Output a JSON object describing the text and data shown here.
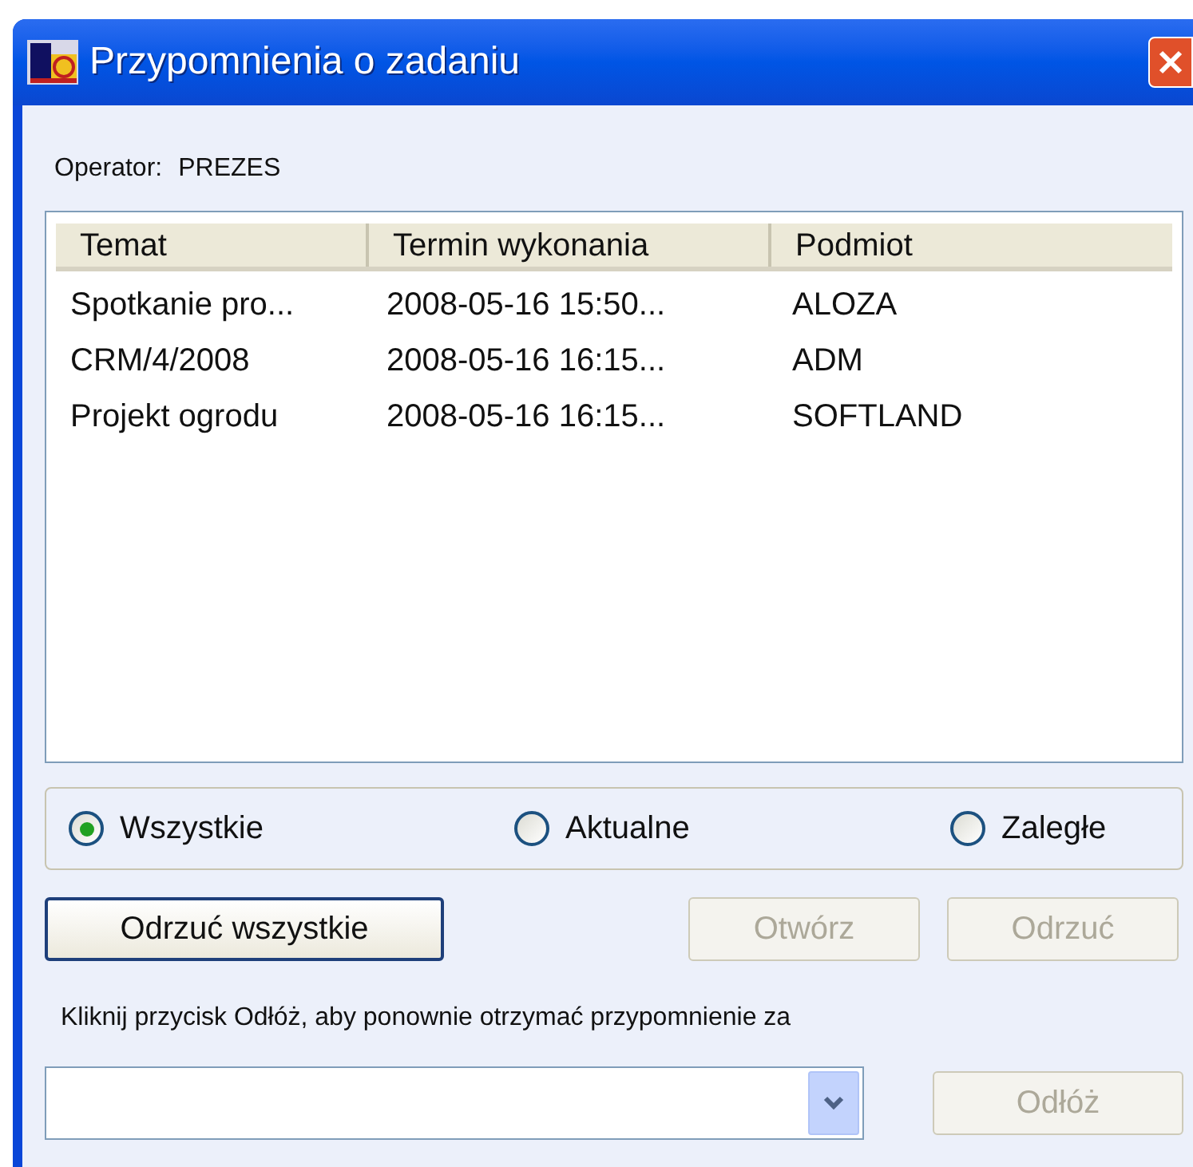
{
  "window": {
    "title": "Przypomnienia o zadaniu"
  },
  "operator": {
    "label": "Operator:",
    "value": "PREZES"
  },
  "table": {
    "columns": [
      "Temat",
      "Termin wykonania",
      "Podmiot"
    ],
    "rows": [
      {
        "cells": [
          "Spotkanie pro...",
          "2008-05-16 15:50...",
          "ALOZA"
        ]
      },
      {
        "cells": [
          "CRM/4/2008",
          "2008-05-16 16:15...",
          "ADM"
        ]
      },
      {
        "cells": [
          "Projekt ogrodu",
          "2008-05-16 16:15...",
          "SOFTLAND"
        ]
      }
    ]
  },
  "filters": [
    {
      "label": "Wszystkie",
      "selected": true
    },
    {
      "label": "Aktualne",
      "selected": false
    },
    {
      "label": "Zaległe",
      "selected": false
    }
  ],
  "buttons": [
    {
      "label": "Odrzuć wszystkie",
      "disabled": false
    },
    {
      "label": "Otwórz",
      "disabled": true
    },
    {
      "label": "Odrzuć",
      "disabled": true
    }
  ],
  "hint": "Kliknij przycisk Odłóż, aby ponownie otrzymać przypomnienie za",
  "snooze_button": {
    "label": "Odłóż",
    "disabled": true
  }
}
